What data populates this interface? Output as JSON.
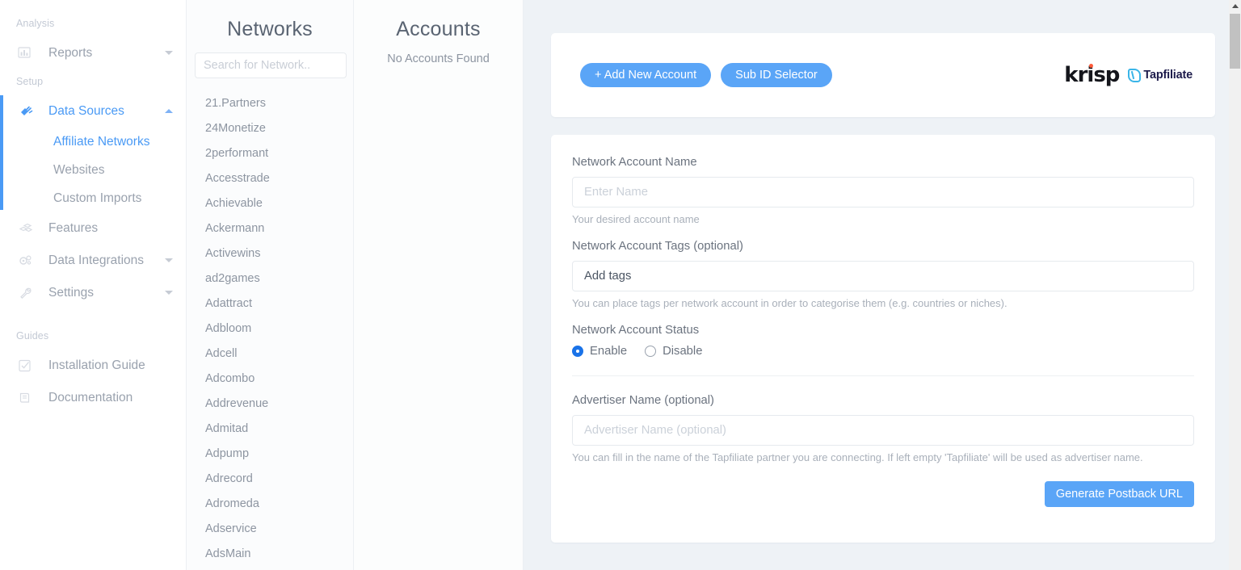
{
  "sidebar": {
    "sections": [
      {
        "label": "Analysis"
      },
      {
        "label": "Setup"
      },
      {
        "label": "Guides"
      }
    ],
    "analysis_items": [
      {
        "label": "Reports",
        "icon": "bar-chart-icon",
        "caret": "down"
      }
    ],
    "setup_items": [
      {
        "label": "Data Sources",
        "icon": "plug-icon",
        "caret": "up",
        "active": true
      },
      {
        "label": "Features",
        "icon": "boxes-icon",
        "caret": "none"
      },
      {
        "label": "Data Integrations",
        "icon": "gears-icon",
        "caret": "down"
      },
      {
        "label": "Settings",
        "icon": "wrench-icon",
        "caret": "down"
      }
    ],
    "data_sources_sub": [
      {
        "label": "Affiliate Networks",
        "active": true
      },
      {
        "label": "Websites",
        "active": false
      },
      {
        "label": "Custom Imports",
        "active": false
      }
    ],
    "guides_items": [
      {
        "label": "Installation Guide",
        "icon": "checkbox-icon"
      },
      {
        "label": "Documentation",
        "icon": "book-icon"
      }
    ],
    "accent_color": "#4a9af5"
  },
  "networks": {
    "title": "Networks",
    "search_placeholder": "Search for Network..",
    "search_value": "",
    "items": [
      "21.Partners",
      "24Monetize",
      "2performant",
      "Accesstrade",
      "Achievable",
      "Ackermann",
      "Activewins",
      "ad2games",
      "Adattract",
      "Adbloom",
      "Adcell",
      "Adcombo",
      "Addrevenue",
      "Admitad",
      "Adpump",
      "Adrecord",
      "Adromeda",
      "Adservice",
      "AdsMain"
    ]
  },
  "accounts": {
    "title": "Accounts",
    "empty_text": "No Accounts Found"
  },
  "toolbar": {
    "add_account_label": "+ Add New Account",
    "sub_id_selector_label": "Sub ID Selector",
    "logo_primary": "krisp",
    "logo_secondary": "Tapfiliate",
    "button_color": "#5aa5f7"
  },
  "form": {
    "account_name": {
      "label": "Network Account Name",
      "placeholder": "Enter Name",
      "value": "",
      "helper": "Your desired account name"
    },
    "account_tags": {
      "label": "Network Account Tags (optional)",
      "placeholder": "Add tags",
      "value": "Add tags",
      "helper": "You can place tags per network account in order to categorise them (e.g. countries or niches)."
    },
    "account_status": {
      "label": "Network Account Status",
      "options": [
        {
          "label": "Enable",
          "selected": true
        },
        {
          "label": "Disable",
          "selected": false
        }
      ]
    },
    "advertiser_name": {
      "label": "Advertiser Name (optional)",
      "placeholder": "Advertiser Name (optional)",
      "value": "",
      "helper": "You can fill in the name of the Tapfiliate partner you are connecting. If left empty 'Tapfiliate' will be used as advertiser name."
    },
    "submit_label": "Generate Postback URL"
  }
}
